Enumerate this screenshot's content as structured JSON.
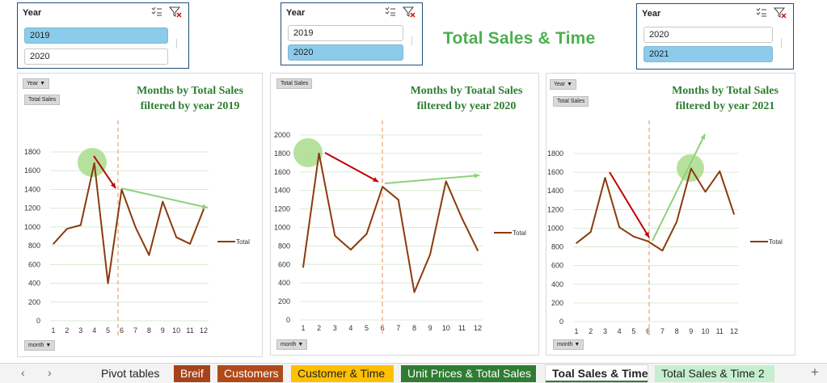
{
  "slicers": [
    {
      "header": "Year",
      "items": [
        {
          "label": "2019",
          "selected": true
        },
        {
          "label": "2020",
          "selected": false
        }
      ]
    },
    {
      "header": "Year",
      "items": [
        {
          "label": "2019",
          "selected": false
        },
        {
          "label": "2020",
          "selected": true
        }
      ]
    },
    {
      "header": "Year",
      "items": [
        {
          "label": "2020",
          "selected": false
        },
        {
          "label": "2021",
          "selected": true
        }
      ]
    }
  ],
  "page_title": "Total Sales & Time",
  "charts": [
    {
      "pills": {
        "year": "Year",
        "values": "Total Sales",
        "axis": "month"
      },
      "title_line1": "Months by Total Sales",
      "title_line2": "filtered by year 2019",
      "legend": "Total"
    },
    {
      "pills": {
        "year": "",
        "values": "Total Sales",
        "axis": "month"
      },
      "title_line1": "Months by Toatal Sales",
      "title_line2": "filtered by year 2020",
      "legend": "Total"
    },
    {
      "pills": {
        "year": "Year",
        "values": "Total Sales",
        "axis": "month"
      },
      "title_line1": "Months by Total Sales",
      "title_line2": "filtered by year 2021",
      "legend": "Total"
    }
  ],
  "chart_data": [
    {
      "type": "line",
      "x": [
        1,
        2,
        3,
        4,
        5,
        6,
        7,
        8,
        9,
        10,
        11,
        12
      ],
      "series": [
        {
          "name": "Total",
          "values": [
            820,
            980,
            1020,
            1680,
            400,
            1400,
            1000,
            700,
            1270,
            890,
            820,
            1190
          ]
        }
      ],
      "ylim": [
        0,
        1800
      ],
      "yticks": [
        0,
        200,
        400,
        600,
        800,
        1000,
        1200,
        1400,
        1600,
        1800
      ],
      "xlabel": "month",
      "color": "#8b3a0e",
      "grid": true,
      "legend": "right"
    },
    {
      "type": "line",
      "x": [
        1,
        2,
        3,
        4,
        5,
        6,
        7,
        8,
        9,
        10,
        11,
        12
      ],
      "series": [
        {
          "name": "Total",
          "values": [
            570,
            1800,
            910,
            760,
            930,
            1440,
            1300,
            300,
            710,
            1500,
            1100,
            750
          ]
        }
      ],
      "ylim": [
        0,
        2000
      ],
      "yticks": [
        0,
        200,
        400,
        600,
        800,
        1000,
        1200,
        1400,
        1600,
        1800,
        2000
      ],
      "xlabel": "month",
      "color": "#8b3a0e",
      "grid": true,
      "legend": "right"
    },
    {
      "type": "line",
      "x": [
        1,
        2,
        3,
        4,
        5,
        6,
        7,
        8,
        9,
        10,
        11,
        12
      ],
      "series": [
        {
          "name": "Total",
          "values": [
            840,
            960,
            1540,
            1010,
            910,
            860,
            760,
            1070,
            1640,
            1390,
            1610,
            1150
          ]
        }
      ],
      "ylim": [
        0,
        1800
      ],
      "yticks": [
        0,
        200,
        400,
        600,
        800,
        1000,
        1200,
        1400,
        1600,
        1800
      ],
      "xlabel": "month",
      "color": "#8b3a0e",
      "grid": true,
      "legend": "right"
    }
  ],
  "sheet_tabs": [
    {
      "label": "Pivot tables",
      "bg": "#f3f3f3",
      "color": "#222222"
    },
    {
      "label": "Breif",
      "bg": "#a5441a",
      "color": "#ffffff"
    },
    {
      "label": "Customers",
      "bg": "#b04a18",
      "color": "#ffffff"
    },
    {
      "label": "Customer & Time",
      "bg": "#ffc000",
      "color": "#222222"
    },
    {
      "label": "Unit Prices & Total Sales",
      "bg": "#2e7d32",
      "color": "#ffffff"
    },
    {
      "label": "Toal Sales & Time",
      "bg": "#ffffff",
      "color": "#222222",
      "active": true
    },
    {
      "label": "Total Sales & Time 2",
      "bg": "#c6efce",
      "color": "#222222"
    }
  ],
  "add_sheet": "+",
  "colors": {
    "line": "#8b3a0e",
    "grid": "#d5ecd0",
    "arrow_red": "#c00000",
    "arrow_green": "#8fd17a",
    "highlight": "#a9dc8c",
    "dashed": "#f4b183",
    "title_green": "#4caf50",
    "chart_title": "#2e7d32"
  }
}
